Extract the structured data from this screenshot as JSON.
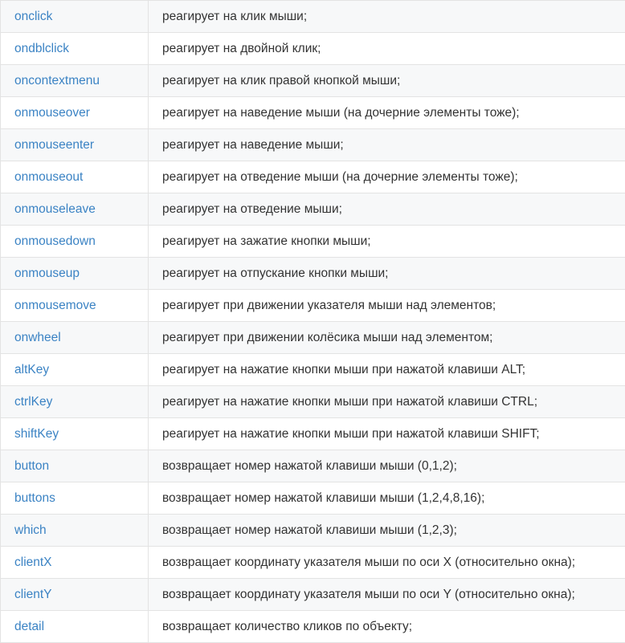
{
  "rows": [
    {
      "name": "onclick",
      "description": "реагирует на клик мыши;"
    },
    {
      "name": "ondblclick",
      "description": "реагирует на двойной клик;"
    },
    {
      "name": "oncontextmenu",
      "description": "реагирует на клик правой кнопкой мыши;"
    },
    {
      "name": "onmouseover",
      "description": "реагирует на наведение мыши (на дочерние элементы тоже);"
    },
    {
      "name": "onmouseenter",
      "description": "реагирует на наведение мыши;"
    },
    {
      "name": "onmouseout",
      "description": "реагирует на отведение мыши (на дочерние элементы тоже);"
    },
    {
      "name": "onmouseleave",
      "description": "реагирует на отведение мыши;"
    },
    {
      "name": "onmousedown",
      "description": "реагирует на зажатие кнопки мыши;"
    },
    {
      "name": "onmouseup",
      "description": "реагирует на отпускание кнопки мыши;"
    },
    {
      "name": "onmousemove",
      "description": "реагирует при движении указателя мыши над элементов;"
    },
    {
      "name": "onwheel",
      "description": "реагирует при движении колёсика мыши над элементом;"
    },
    {
      "name": "altKey",
      "description": "реагирует на нажатие кнопки мыши при нажатой клавиши ALT;"
    },
    {
      "name": "ctrlKey",
      "description": "реагирует на нажатие кнопки мыши при нажатой клавиши CTRL;"
    },
    {
      "name": "shiftKey",
      "description": "реагирует на нажатие кнопки мыши при нажатой клавиши SHIFT;"
    },
    {
      "name": "button",
      "description": "возвращает номер нажатой клавиши мыши (0,1,2);"
    },
    {
      "name": "buttons",
      "description": "возвращает номер нажатой клавиши мыши (1,2,4,8,16);"
    },
    {
      "name": "which",
      "description": "возвращает номер нажатой клавиши мыши (1,2,3);"
    },
    {
      "name": "clientX",
      "description": "возвращает координату указателя мыши по оси X (относительно окна);"
    },
    {
      "name": "clientY",
      "description": "возвращает координату указателя мыши по оси Y (относительно окна);"
    },
    {
      "name": "detail",
      "description": "возвращает количество кликов по объекту;"
    }
  ],
  "colors": {
    "link": "#3b83c4",
    "text": "#333333",
    "row_alt": "#f7f8f9",
    "border": "#e3e3e3"
  }
}
